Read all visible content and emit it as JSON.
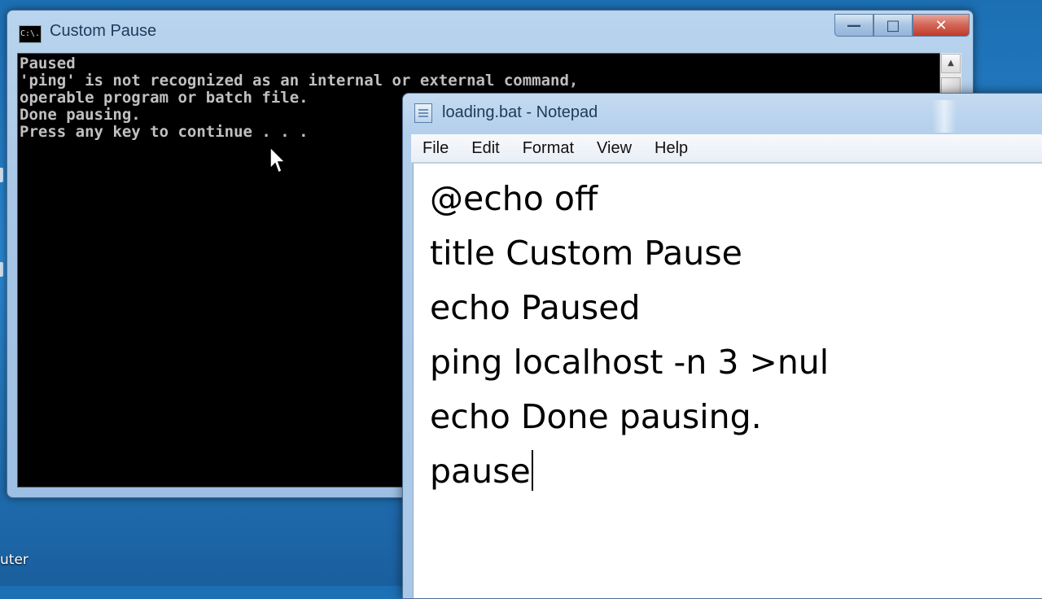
{
  "desktop": {
    "partial_label": "uter"
  },
  "cmd_window": {
    "title": "Custom Pause",
    "icon": "cmd-icon",
    "icon_text": "C:\\.",
    "console_lines": [
      "Paused",
      "'ping' is not recognized as an internal or external command,",
      "operable program or batch file.",
      "Done pausing.",
      "Press any key to continue . . ."
    ],
    "controls": {
      "minimize": "—",
      "maximize": "□",
      "close": "✕"
    }
  },
  "notepad_window": {
    "title": "loading.bat - Notepad",
    "menu": [
      "File",
      "Edit",
      "Format",
      "View",
      "Help"
    ],
    "lines": [
      "@echo off",
      "title Custom Pause",
      "echo Paused",
      "ping localhost -n 3 >nul",
      "echo Done pausing.",
      "pause"
    ]
  },
  "colors": {
    "console_bg": "#000000",
    "console_text": "#c0c0c0",
    "close_button": "#c0392b",
    "aero_frame": "#a9c7e7"
  }
}
